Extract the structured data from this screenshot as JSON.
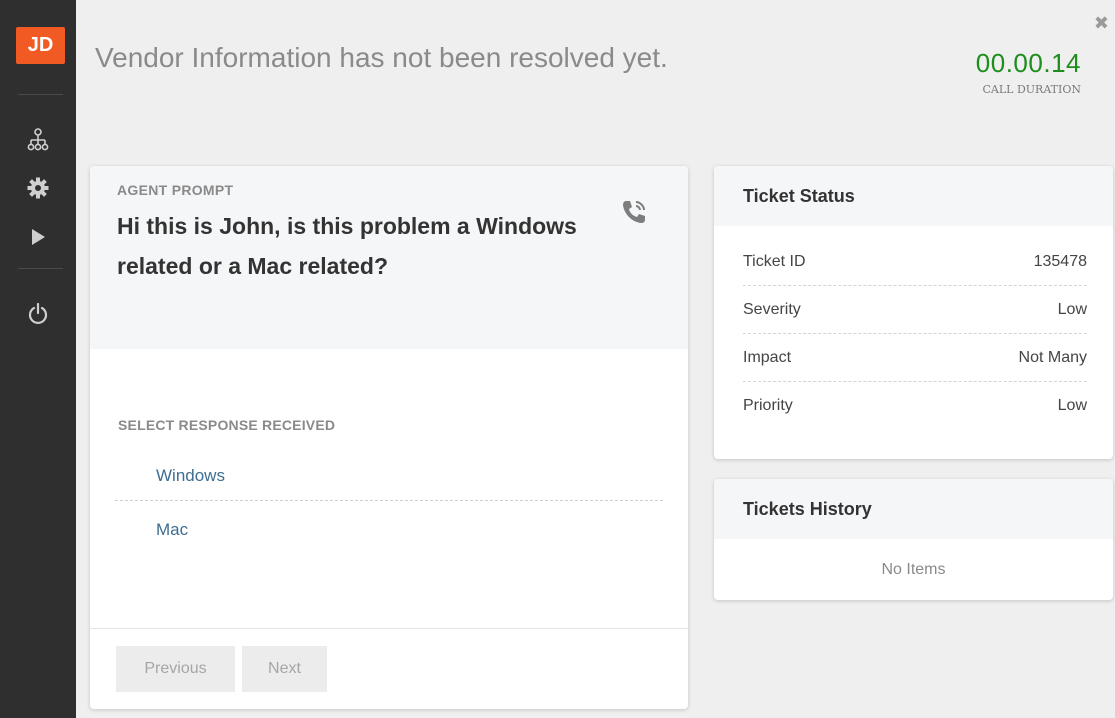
{
  "sidebar": {
    "avatar_initials": "JD",
    "avatar_color": "#f25a23",
    "icons": [
      "sitemap-icon",
      "gear-icon",
      "play-icon",
      "power-icon"
    ]
  },
  "header": {
    "message": "Vendor Information has not been resolved yet.",
    "call_duration": "00.00.14",
    "call_duration_label": "CALL DURATION",
    "duration_color": "#1d8e1d"
  },
  "prompt": {
    "label": "AGENT PROMPT",
    "text": "Hi this is John, is this problem a Windows related or a Mac related?",
    "response_label": "SELECT RESPONSE RECEIVED",
    "responses": [
      "Windows",
      "Mac"
    ],
    "previous_label": "Previous",
    "next_label": "Next"
  },
  "ticket_status": {
    "title": "Ticket Status",
    "rows": [
      {
        "label": "Ticket ID",
        "value": "135478"
      },
      {
        "label": "Severity",
        "value": "Low"
      },
      {
        "label": "Impact",
        "value": "Not Many"
      },
      {
        "label": "Priority",
        "value": "Low"
      }
    ]
  },
  "tickets_history": {
    "title": "Tickets History",
    "empty_text": "No Items"
  }
}
